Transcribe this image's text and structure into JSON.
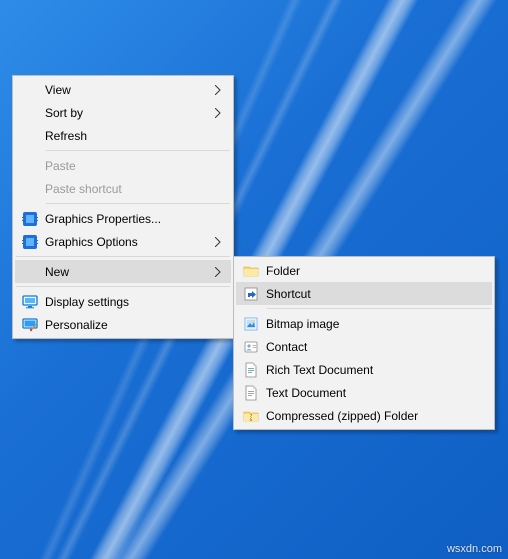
{
  "wallpaper": {
    "type": "windows10-light-rays",
    "accent": "#0f5fc4"
  },
  "watermark": "wsxdn.com",
  "context_menu": {
    "view": {
      "label": "View",
      "submenu": true
    },
    "sort_by": {
      "label": "Sort by",
      "submenu": true
    },
    "refresh": {
      "label": "Refresh"
    },
    "paste": {
      "label": "Paste",
      "enabled": false
    },
    "paste_shortcut": {
      "label": "Paste shortcut",
      "enabled": false
    },
    "graphics_properties": {
      "label": "Graphics Properties...",
      "icon": "intel-graphics-chip"
    },
    "graphics_options": {
      "label": "Graphics Options",
      "icon": "intel-graphics-chip",
      "submenu": true
    },
    "new": {
      "label": "New",
      "submenu": true,
      "highlighted": true
    },
    "display_settings": {
      "label": "Display settings",
      "icon": "monitor"
    },
    "personalize": {
      "label": "Personalize",
      "icon": "personalize-brush"
    }
  },
  "new_submenu": {
    "folder": {
      "label": "Folder",
      "icon": "folder"
    },
    "shortcut": {
      "label": "Shortcut",
      "icon": "shortcut-arrow",
      "highlighted": true
    },
    "bitmap": {
      "label": "Bitmap image",
      "icon": "paint-image"
    },
    "contact": {
      "label": "Contact",
      "icon": "contact-card"
    },
    "rtf": {
      "label": "Rich Text Document",
      "icon": "document-lines"
    },
    "txt": {
      "label": "Text Document",
      "icon": "document-lines"
    },
    "zip": {
      "label": "Compressed (zipped) Folder",
      "icon": "zipped-folder"
    }
  }
}
